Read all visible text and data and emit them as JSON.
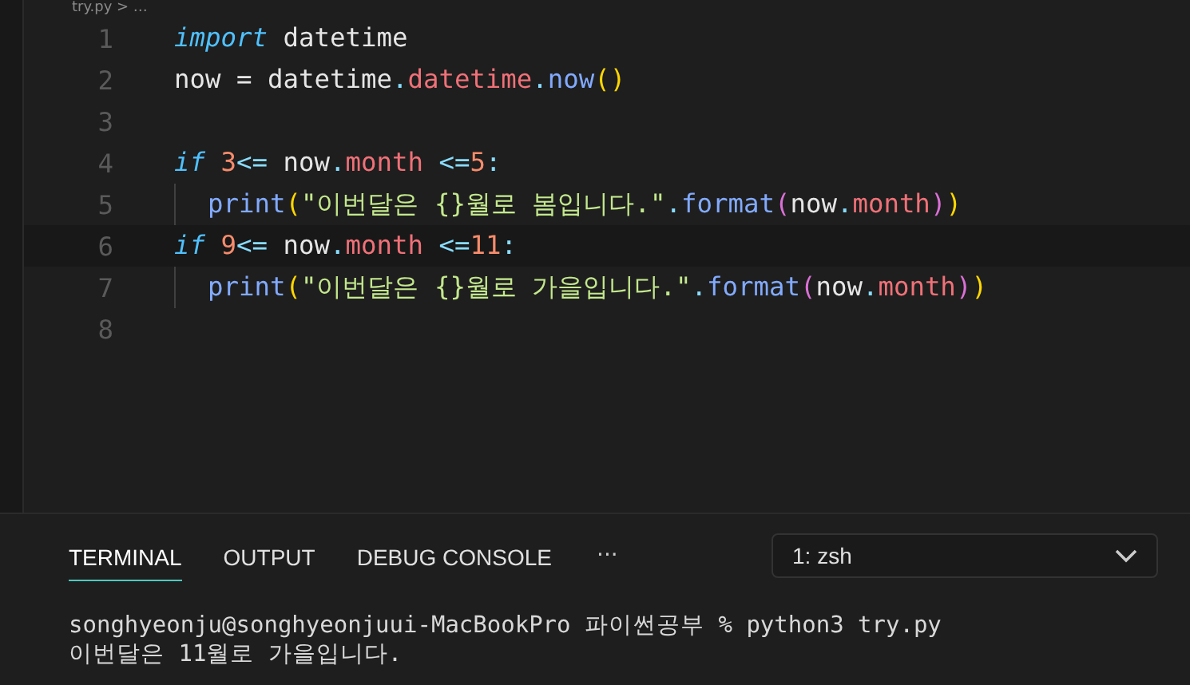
{
  "breadcrumb": "try.py > …",
  "editor": {
    "lines": [
      {
        "number": "1",
        "current": false,
        "indent": false,
        "tokens": [
          {
            "kind": "keyword",
            "text": "import"
          },
          {
            "kind": "plain",
            "text": " datetime"
          }
        ]
      },
      {
        "number": "2",
        "current": false,
        "indent": false,
        "tokens": [
          {
            "kind": "plain",
            "text": "now = datetime"
          },
          {
            "kind": "punct",
            "text": "."
          },
          {
            "kind": "attr",
            "text": "datetime"
          },
          {
            "kind": "punct",
            "text": "."
          },
          {
            "kind": "func",
            "text": "now"
          },
          {
            "kind": "paren",
            "text": "()"
          }
        ]
      },
      {
        "number": "3",
        "current": false,
        "indent": false
      },
      {
        "number": "4",
        "current": false,
        "indent": false,
        "tokens": [
          {
            "kind": "keyword",
            "text": "if"
          },
          {
            "kind": "number",
            "text": " 3"
          },
          {
            "kind": "punct",
            "text": "<="
          },
          {
            "kind": "plain",
            "text": " now"
          },
          {
            "kind": "punct",
            "text": "."
          },
          {
            "kind": "attr",
            "text": "month"
          },
          {
            "kind": "punct",
            "text": " <="
          },
          {
            "kind": "number",
            "text": "5"
          },
          {
            "kind": "punct",
            "text": ":"
          }
        ]
      },
      {
        "number": "5",
        "current": false,
        "indent": true,
        "tokens": [
          {
            "kind": "func",
            "text": "print"
          },
          {
            "kind": "paren",
            "text": "("
          },
          {
            "kind": "string",
            "text": "\"이번달은 {}월로 봄입니다.\""
          },
          {
            "kind": "punct",
            "text": "."
          },
          {
            "kind": "func",
            "text": "format"
          },
          {
            "kind": "paren2",
            "text": "("
          },
          {
            "kind": "plain",
            "text": "now"
          },
          {
            "kind": "punct",
            "text": "."
          },
          {
            "kind": "attr",
            "text": "month"
          },
          {
            "kind": "paren2",
            "text": ")"
          },
          {
            "kind": "paren",
            "text": ")"
          }
        ]
      },
      {
        "number": "6",
        "current": true,
        "indent": false,
        "tokens": [
          {
            "kind": "keyword",
            "text": "if"
          },
          {
            "kind": "number",
            "text": " 9"
          },
          {
            "kind": "punct",
            "text": "<="
          },
          {
            "kind": "plain",
            "text": " now"
          },
          {
            "kind": "punct",
            "text": "."
          },
          {
            "kind": "attr",
            "text": "month"
          },
          {
            "kind": "punct",
            "text": " <="
          },
          {
            "kind": "number",
            "text": "11"
          },
          {
            "kind": "punct",
            "text": ":"
          }
        ]
      },
      {
        "number": "7",
        "current": false,
        "indent": true,
        "tokens": [
          {
            "kind": "func",
            "text": "print"
          },
          {
            "kind": "paren",
            "text": "("
          },
          {
            "kind": "string",
            "text": "\"이번달은 {}월로 가을입니다.\""
          },
          {
            "kind": "punct",
            "text": "."
          },
          {
            "kind": "func",
            "text": "format"
          },
          {
            "kind": "paren2",
            "text": "("
          },
          {
            "kind": "plain",
            "text": "now"
          },
          {
            "kind": "punct",
            "text": "."
          },
          {
            "kind": "attr",
            "text": "month"
          },
          {
            "kind": "paren2",
            "text": ")"
          },
          {
            "kind": "paren",
            "text": ")"
          }
        ]
      },
      {
        "number": "8",
        "current": false,
        "indent": false
      }
    ]
  },
  "panel": {
    "tabs": [
      {
        "label": "TERMINAL",
        "selected": true
      },
      {
        "label": "OUTPUT",
        "selected": false
      },
      {
        "label": "DEBUG CONSOLE",
        "selected": false
      }
    ],
    "more": "···",
    "terminal_select": "1: zsh",
    "terminal_lines": [
      "songhyeonju@songhyeonjuui-MacBookPro 파이썬공부 % python3 try.py",
      "이번달은 11월로 가을입니다."
    ]
  }
}
